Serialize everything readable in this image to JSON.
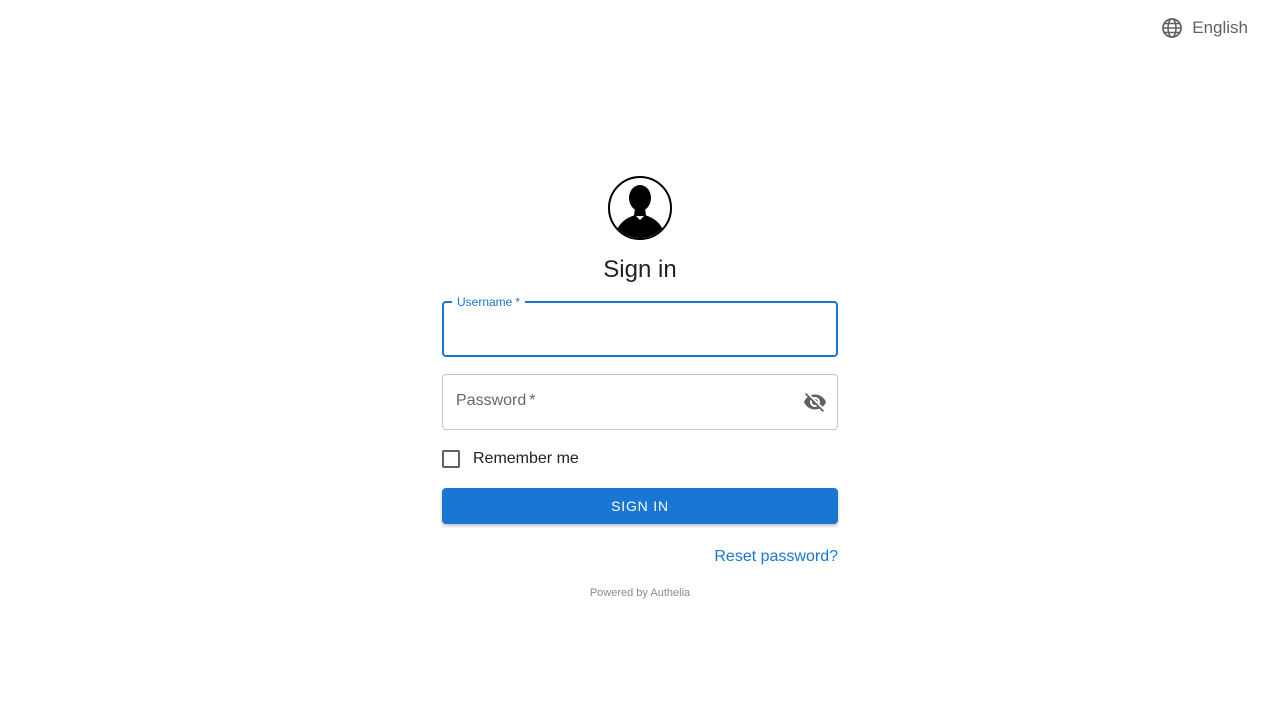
{
  "header": {
    "language_label": "English",
    "language_icon": "globe-icon"
  },
  "login": {
    "avatar_icon": "user-silhouette-icon",
    "title": "Sign in",
    "username": {
      "label": "Username",
      "required_mark": "*",
      "value": ""
    },
    "password": {
      "label": "Password",
      "required_mark": "*",
      "value": "",
      "toggle_icon": "eye-off-icon"
    },
    "remember_me": {
      "label": "Remember me",
      "checked": false
    },
    "sign_in_label": "SIGN IN",
    "reset_password_label": "Reset password?",
    "powered_by": "Powered by Authelia"
  },
  "colors": {
    "primary": "#1976d2",
    "text": "#212121",
    "muted": "#616161"
  }
}
